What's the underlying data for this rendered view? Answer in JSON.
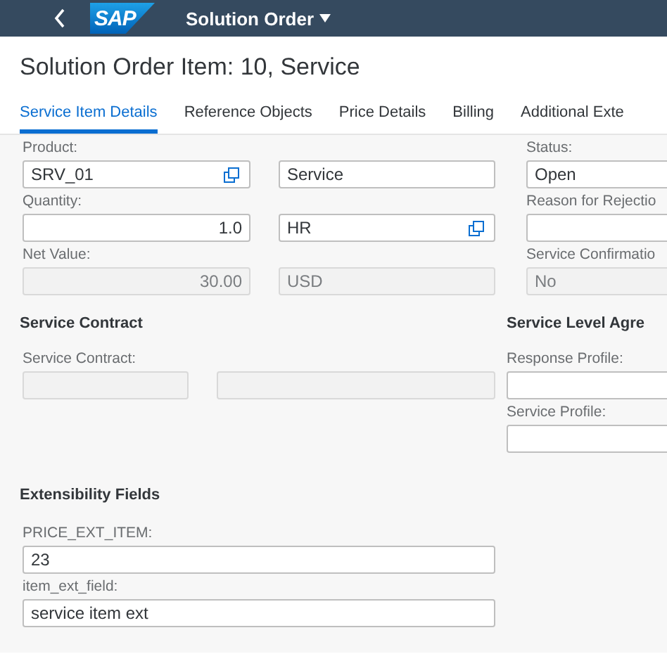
{
  "shell": {
    "logo": "SAP",
    "title": "Solution Order"
  },
  "page_title": "Solution Order Item: 10, Service",
  "tabs": [
    {
      "label": "Service Item Details",
      "selected": true
    },
    {
      "label": "Reference Objects",
      "selected": false
    },
    {
      "label": "Price Details",
      "selected": false
    },
    {
      "label": "Billing",
      "selected": false
    },
    {
      "label": "Additional Exte",
      "selected": false
    }
  ],
  "general": {
    "rows": [
      [
        {
          "label": "Product:",
          "value": "SRV_01",
          "kind": "text",
          "value_help": true,
          "disabled": false
        },
        {
          "value": "Service",
          "kind": "text",
          "value_help": false,
          "disabled": false
        },
        {
          "label": "Status:",
          "value": "Open",
          "kind": "text",
          "value_help": false,
          "disabled": false
        }
      ],
      [
        {
          "label": "Quantity:",
          "value": "1.0",
          "kind": "number",
          "value_help": false,
          "disabled": false
        },
        {
          "value": "HR",
          "kind": "text",
          "value_help": true,
          "disabled": false
        },
        {
          "label": "Reason for Rejectio",
          "value_help": false,
          "disabled": false
        }
      ],
      [
        {
          "label": "Net Value:",
          "value": "30.00",
          "kind": "number",
          "value_help": false,
          "disabled": true
        },
        {
          "value": "USD",
          "kind": "text",
          "value_help": false,
          "disabled": true
        },
        {
          "label": "Service Confirmatio",
          "value": "No",
          "kind": "text",
          "value_help": false,
          "disabled": true
        }
      ]
    ]
  },
  "service_contract": {
    "heading": "Service Contract",
    "fields": [
      {
        "label": "Service Contract:",
        "value_help": false,
        "disabled": true
      },
      {
        "value_help": false,
        "disabled": true
      }
    ]
  },
  "service_level": {
    "heading": "Service Level Agre",
    "fields": [
      {
        "label": "Response Profile:",
        "value_help": false,
        "disabled": false
      },
      {
        "label": "Service Profile:",
        "value_help": false,
        "disabled": false
      }
    ]
  },
  "extensibility": {
    "heading": "Extensibility Fields",
    "fields": [
      {
        "label": "PRICE_EXT_ITEM:",
        "value": "23",
        "value_help": false,
        "disabled": false
      },
      {
        "label": "item_ext_field:",
        "value": "service item ext",
        "value_help": false,
        "disabled": false
      }
    ]
  }
}
